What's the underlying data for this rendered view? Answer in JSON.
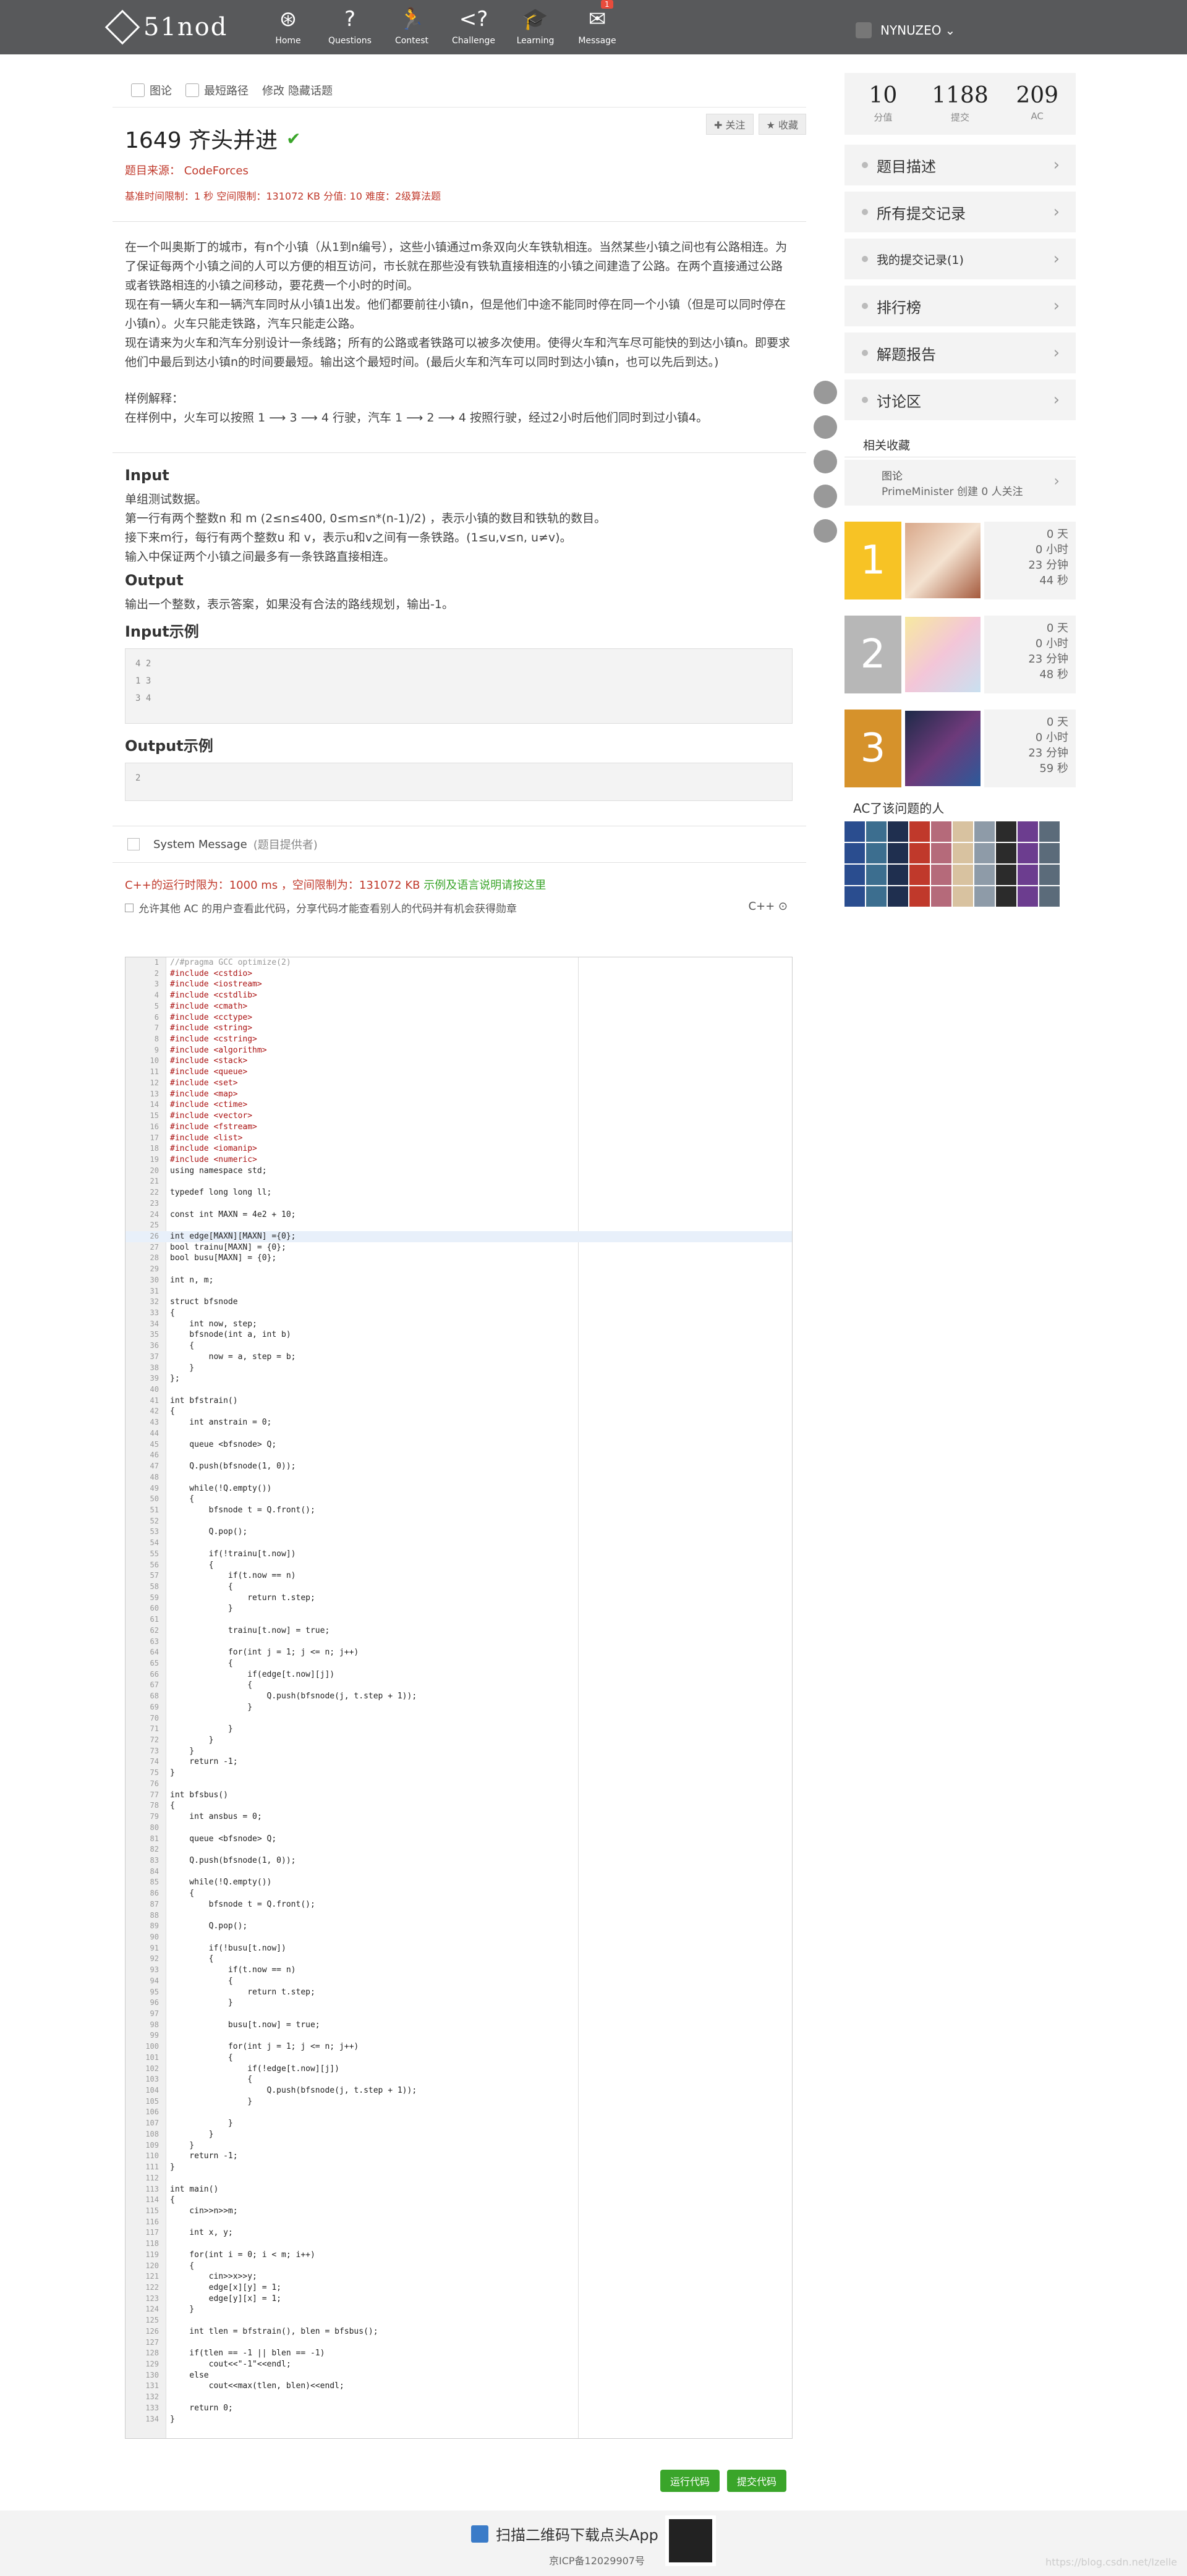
{
  "nav": {
    "logo": "51nod",
    "items": [
      {
        "label": "Home",
        "icon": "home-icon"
      },
      {
        "label": "Questions",
        "icon": "question-icon"
      },
      {
        "label": "Contest",
        "icon": "contest-icon"
      },
      {
        "label": "Challenge",
        "icon": "challenge-icon"
      },
      {
        "label": "Learning",
        "icon": "learning-icon"
      },
      {
        "label": "Message",
        "icon": "message-icon",
        "badge": "1"
      }
    ],
    "username": "NYNUZEO"
  },
  "breadcrumb": {
    "tag1": "图论",
    "tag2": "最短路径",
    "edit": "修改",
    "hide": "隐藏话题"
  },
  "problem": {
    "id_title": "1649 齐头并进",
    "follow": "关注",
    "collect": "收藏",
    "source": "题目来源：  CodeForces",
    "limits": "基准时间限制：1 秒 空间限制：131072 KB 分值: 10 难度：2级算法题",
    "description": [
      "在一个叫奥斯丁的城市，有n个小镇（从1到n编号），这些小镇通过m条双向火车铁轨相连。当然某些小镇之间也有公路相连。为了保证每两个小镇之间的人可以方便的相互访问，市长就在那些没有铁轨直接相连的小镇之间建造了公路。在两个直接通过公路或者铁路相连的小镇之间移动，要花费一个小时的时间。",
      "现在有一辆火车和一辆汽车同时从小镇1出发。他们都要前往小镇n，但是他们中途不能同时停在同一个小镇（但是可以同时停在小镇n）。火车只能走铁路，汽车只能走公路。",
      "现在请来为火车和汽车分别设计一条线路；所有的公路或者铁路可以被多次使用。使得火车和汽车尽可能快的到达小镇n。即要求他们中最后到达小镇n的时间要最短。输出这个最短时间。(最后火车和汽车可以同时到达小镇n，也可以先后到达。)"
    ],
    "sample_explain_title": "样例解释：",
    "sample_explain": "在样例中，火车可以按照 1 ⟶ 3 ⟶ 4 行驶，汽车 1 ⟶ 2 ⟶ 4 按照行驶，经过2小时后他们同时到过小镇4。",
    "input_title": "Input",
    "input_lines": [
      "单组测试数据。",
      "第一行有两个整数n 和 m (2≤n≤400, 0≤m≤n*(n-1)/2) ，表示小镇的数目和铁轨的数目。",
      "接下来m行，每行有两个整数u 和 v，表示u和v之间有一条铁路。(1≤u,v≤n, u≠v)。",
      "输入中保证两个小镇之间最多有一条铁路直接相连。"
    ],
    "output_title": "Output",
    "output_text": "输出一个整数，表示答案，如果没有合法的路线规划，输出-1。",
    "input_sample_title": "Input示例",
    "input_sample": [
      "4 2",
      "1 3",
      "3 4"
    ],
    "output_sample_title": "Output示例",
    "output_sample": [
      "2"
    ]
  },
  "system": {
    "title": "System Message",
    "provider": "(题目提供者)",
    "runtime_prefix": "C++的运行时限为：1000 ms ，空间限制为：131072 KB ",
    "runtime_link": "示例及语言说明请按这里",
    "share": "允许其他 AC 的用户查看此代码，分享代码才能查看别人的代码并有机会获得勋章",
    "lang": "C++ ⊙"
  },
  "code_lines": [
    "//#pragma GCC optimize(2)",
    "#include <cstdio>",
    "#include <iostream>",
    "#include <cstdlib>",
    "#include <cmath>",
    "#include <cctype>",
    "#include <string>",
    "#include <cstring>",
    "#include <algorithm>",
    "#include <stack>",
    "#include <queue>",
    "#include <set>",
    "#include <map>",
    "#include <ctime>",
    "#include <vector>",
    "#include <fstream>",
    "#include <list>",
    "#include <iomanip>",
    "#include <numeric>",
    "using namespace std;",
    "",
    "typedef long long ll;",
    "",
    "const int MAXN = 4e2 + 10;",
    "",
    "int edge[MAXN][MAXN] ={0};",
    "bool trainu[MAXN] = {0};",
    "bool busu[MAXN] = {0};",
    "",
    "int n, m;",
    "",
    "struct bfsnode",
    "{",
    "    int now, step;",
    "    bfsnode(int a, int b)",
    "    {",
    "        now = a, step = b;",
    "    }",
    "};",
    "",
    "int bfstrain()",
    "{",
    "    int anstrain = 0;",
    "",
    "    queue <bfsnode> Q;",
    "",
    "    Q.push(bfsnode(1, 0));",
    "",
    "    while(!Q.empty())",
    "    {",
    "        bfsnode t = Q.front();",
    "",
    "        Q.pop();",
    "",
    "        if(!trainu[t.now])",
    "        {",
    "            if(t.now == n)",
    "            {",
    "                return t.step;",
    "            }",
    "",
    "            trainu[t.now] = true;",
    "",
    "            for(int j = 1; j <= n; j++)",
    "            {",
    "                if(edge[t.now][j])",
    "                {",
    "                    Q.push(bfsnode(j, t.step + 1));",
    "                }",
    "",
    "            }",
    "        }",
    "    }",
    "    return -1;",
    "}",
    "",
    "int bfsbus()",
    "{",
    "    int ansbus = 0;",
    "",
    "    queue <bfsnode> Q;",
    "",
    "    Q.push(bfsnode(1, 0));",
    "",
    "    while(!Q.empty())",
    "    {",
    "        bfsnode t = Q.front();",
    "",
    "        Q.pop();",
    "",
    "        if(!busu[t.now])",
    "        {",
    "            if(t.now == n)",
    "            {",
    "                return t.step;",
    "            }",
    "",
    "            busu[t.now] = true;",
    "",
    "            for(int j = 1; j <= n; j++)",
    "            {",
    "                if(!edge[t.now][j])",
    "                {",
    "                    Q.push(bfsnode(j, t.step + 1));",
    "                }",
    "",
    "            }",
    "        }",
    "    }",
    "    return -1;",
    "}",
    "",
    "int main()",
    "{",
    "    cin>>n>>m;",
    "",
    "    int x, y;",
    "",
    "    for(int i = 0; i < m; i++)",
    "    {",
    "        cin>>x>>y;",
    "        edge[x][y] = 1;",
    "        edge[y][x] = 1;",
    "    }",
    "",
    "    int tlen = bfstrain(), blen = bfsbus();",
    "",
    "    if(tlen == -1 || blen == -1)",
    "        cout<<\"-1\"<<endl;",
    "    else",
    "        cout<<max(tlen, blen)<<endl;",
    "",
    "    return 0;",
    "}"
  ],
  "buttons": {
    "run": "运行代码",
    "submit": "提交代码"
  },
  "sidebar": {
    "stats": [
      {
        "num": "10",
        "label": "分值"
      },
      {
        "num": "1188",
        "label": "提交"
      },
      {
        "num": "209",
        "label": "AC"
      }
    ],
    "menu": [
      {
        "label": "题目描述"
      },
      {
        "label": "所有提交记录"
      },
      {
        "label": "我的提交记录(1)"
      },
      {
        "label": "排行榜"
      },
      {
        "label": "解题报告"
      },
      {
        "label": "讨论区"
      }
    ],
    "collection_title": "相关收藏",
    "collection_item": "图论",
    "collection_sub": "PrimeMinister 创建 0 人关注",
    "ranks": [
      {
        "n": "1",
        "d": "0 天",
        "h": "0 小时",
        "m": "23 分钟",
        "s": "44 秒",
        "color": "#f7c325"
      },
      {
        "n": "2",
        "d": "0 天",
        "h": "0 小时",
        "m": "23 分钟",
        "s": "48 秒",
        "color": "#b7b7b7"
      },
      {
        "n": "3",
        "d": "0 天",
        "h": "0 小时",
        "m": "23 分钟",
        "s": "59 秒",
        "color": "#d6922b"
      }
    ],
    "ac_people": "AC了该问题的人"
  },
  "footer": {
    "app": "扫描二维码下载点头App",
    "icp": "京ICP备12029907号",
    "watermark": "https://blog.csdn.net/Izelle"
  }
}
